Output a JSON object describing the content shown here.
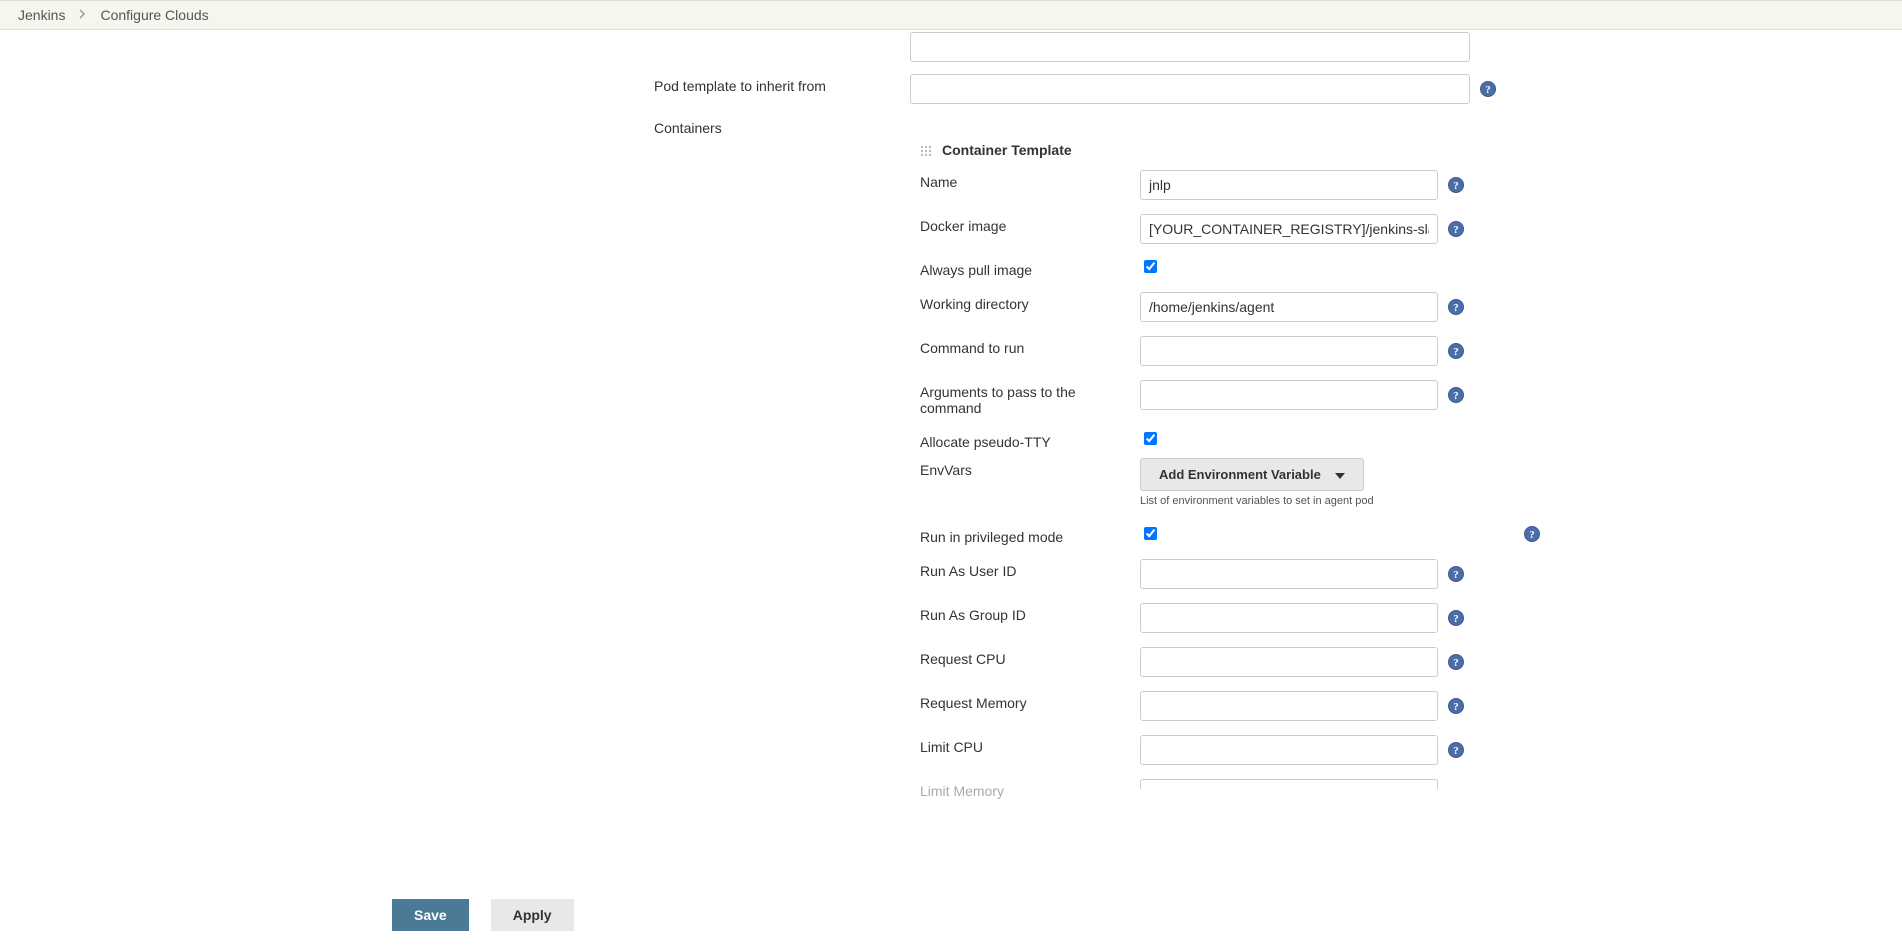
{
  "breadcrumb": {
    "root": "Jenkins",
    "current": "Configure Clouds"
  },
  "labels": {
    "podTemplateInherit": "Pod template to inherit from",
    "containers": "Containers"
  },
  "containerTemplate": {
    "header": "Container Template",
    "name": {
      "label": "Name",
      "value": "jnlp"
    },
    "dockerImage": {
      "label": "Docker image",
      "value": "[YOUR_CONTAINER_REGISTRY]/jenkins-slave"
    },
    "alwaysPull": {
      "label": "Always pull image",
      "checked": true
    },
    "workingDir": {
      "label": "Working directory",
      "value": "/home/jenkins/agent"
    },
    "command": {
      "label": "Command to run",
      "value": ""
    },
    "args": {
      "label": "Arguments to pass to the command",
      "value": ""
    },
    "pseudoTTY": {
      "label": "Allocate pseudo-TTY",
      "checked": true
    },
    "envVars": {
      "label": "EnvVars",
      "button": "Add Environment Variable",
      "desc": "List of environment variables to set in agent pod"
    },
    "privileged": {
      "label": "Run in privileged mode",
      "checked": true
    },
    "runAsUser": {
      "label": "Run As User ID",
      "value": ""
    },
    "runAsGroup": {
      "label": "Run As Group ID",
      "value": ""
    },
    "requestCpu": {
      "label": "Request CPU",
      "value": ""
    },
    "requestMemory": {
      "label": "Request Memory",
      "value": ""
    },
    "limitCpu": {
      "label": "Limit CPU",
      "value": ""
    },
    "limitMemory": {
      "label": "Limit Memory",
      "value": ""
    }
  },
  "buttons": {
    "save": "Save",
    "apply": "Apply"
  }
}
